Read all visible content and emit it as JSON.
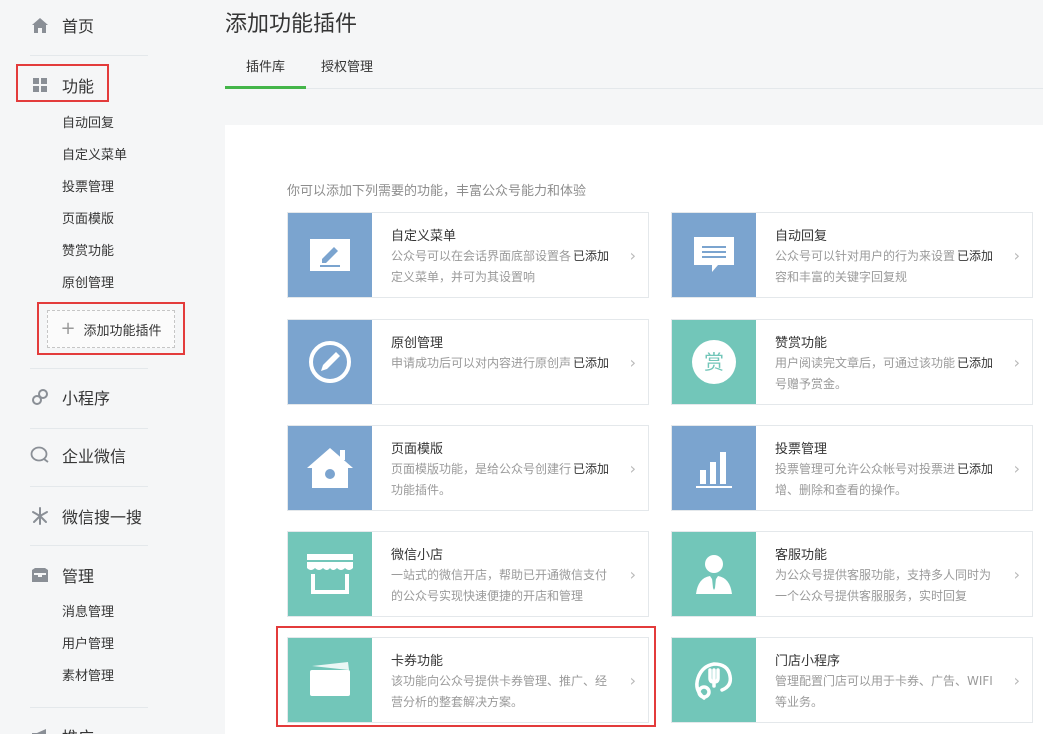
{
  "sidebar": {
    "home": "首页",
    "features": "功能",
    "feature_items": [
      "自动回复",
      "自定义菜单",
      "投票管理",
      "页面模版",
      "赞赏功能",
      "原创管理"
    ],
    "add_plugin": "添加功能插件",
    "mini_program": "小程序",
    "enterprise_wechat": "企业微信",
    "search": "微信搜一搜",
    "manage": "管理",
    "manage_items": [
      "消息管理",
      "用户管理",
      "素材管理"
    ],
    "promote": "推广"
  },
  "header": {
    "title": "添加功能插件",
    "tabs": [
      "插件库",
      "授权管理"
    ]
  },
  "main": {
    "intro": "你可以添加下列需要的功能，丰富公众号能力和体验",
    "cards": [
      {
        "title": "自定义菜单",
        "desc": "公众号可以在会话界面底部设置各样的自定义菜单，并可为其设置响",
        "status": "已添加",
        "icon": "edit-square-icon"
      },
      {
        "title": "自动回复",
        "desc": "公众号可以针对用户的行为来设置回复内容和丰富的关键字回复规",
        "status": "已添加",
        "icon": "message-icon"
      },
      {
        "title": "原创管理",
        "desc": "申请成功后可以对内容进行原创声明",
        "status": "已添加",
        "icon": "pencil-circle-icon"
      },
      {
        "title": "赞赏功能",
        "desc": "用户阅读完文章后，可通过该功能向公众号赠予赏金。",
        "status": "已添加",
        "icon": "reward-icon"
      },
      {
        "title": "页面模版",
        "desc": "页面模版功能，是给公众号创建行业页的功能插件。",
        "status": "已添加",
        "icon": "house-icon"
      },
      {
        "title": "投票管理",
        "desc": "投票管理可允许公众帐号对投票进行新增、删除和查看的操作。",
        "status": "已添加",
        "icon": "bar-chart-icon"
      },
      {
        "title": "微信小店",
        "desc": "一站式的微信开店，帮助已开通微信支付的公众号实现快速便捷的开店和管理",
        "status": "",
        "icon": "shop-icon"
      },
      {
        "title": "客服功能",
        "desc": "为公众号提供客服功能，支持多人同时为一个公众号提供客服服务，实时回复",
        "status": "",
        "icon": "service-person-icon"
      },
      {
        "title": "卡券功能",
        "desc": "该功能向公众号提供卡券管理、推广、经营分析的整套解决方案。",
        "status": "",
        "icon": "card-icon"
      },
      {
        "title": "门店小程序",
        "desc": "管理配置门店可以用于卡券、广告、WIFI等业务。",
        "status": "",
        "icon": "fork-pin-icon"
      }
    ],
    "arrow": "›"
  },
  "colors": {
    "accent": "#44b549",
    "highlight": "#e33b3b",
    "icon_blue": "#7ba4cf",
    "icon_teal": "#72c6b9"
  }
}
